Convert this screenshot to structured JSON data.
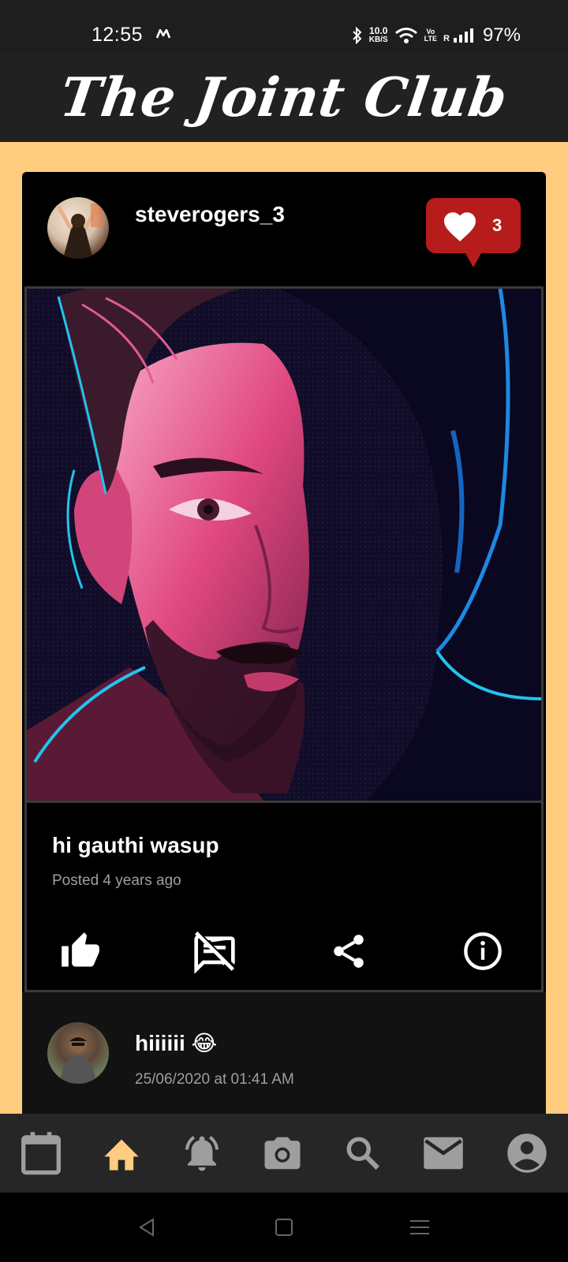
{
  "status_bar": {
    "time": "12:55",
    "net_speed_value": "10.0",
    "net_speed_unit": "KB/S",
    "volte_top": "Vo",
    "volte_bottom": "LTE",
    "roaming": "R",
    "battery": "97%"
  },
  "app": {
    "title": "The Joint Club"
  },
  "post": {
    "username": "steverogers_3",
    "like_count": "3",
    "caption": "hi gauthi wasup",
    "posted": "Posted 4 years ago",
    "actions": [
      "thumb-up-icon",
      "comments-disabled-icon",
      "share-icon",
      "info-icon"
    ]
  },
  "comment": {
    "text": "hiiiiii 😂",
    "timestamp": "25/06/2020 at 01:41 AM"
  },
  "bottom_nav": {
    "items": [
      "calendar-icon",
      "home-icon",
      "notifications-icon",
      "camera-icon",
      "search-icon",
      "mail-icon",
      "account-icon"
    ],
    "active": "home-icon"
  },
  "colors": {
    "background": "#FFCC80",
    "title_bar": "#212121",
    "like_badge": "#B71C1C",
    "active_nav": "#FFCC80",
    "inactive_nav": "#9E9E9E"
  }
}
